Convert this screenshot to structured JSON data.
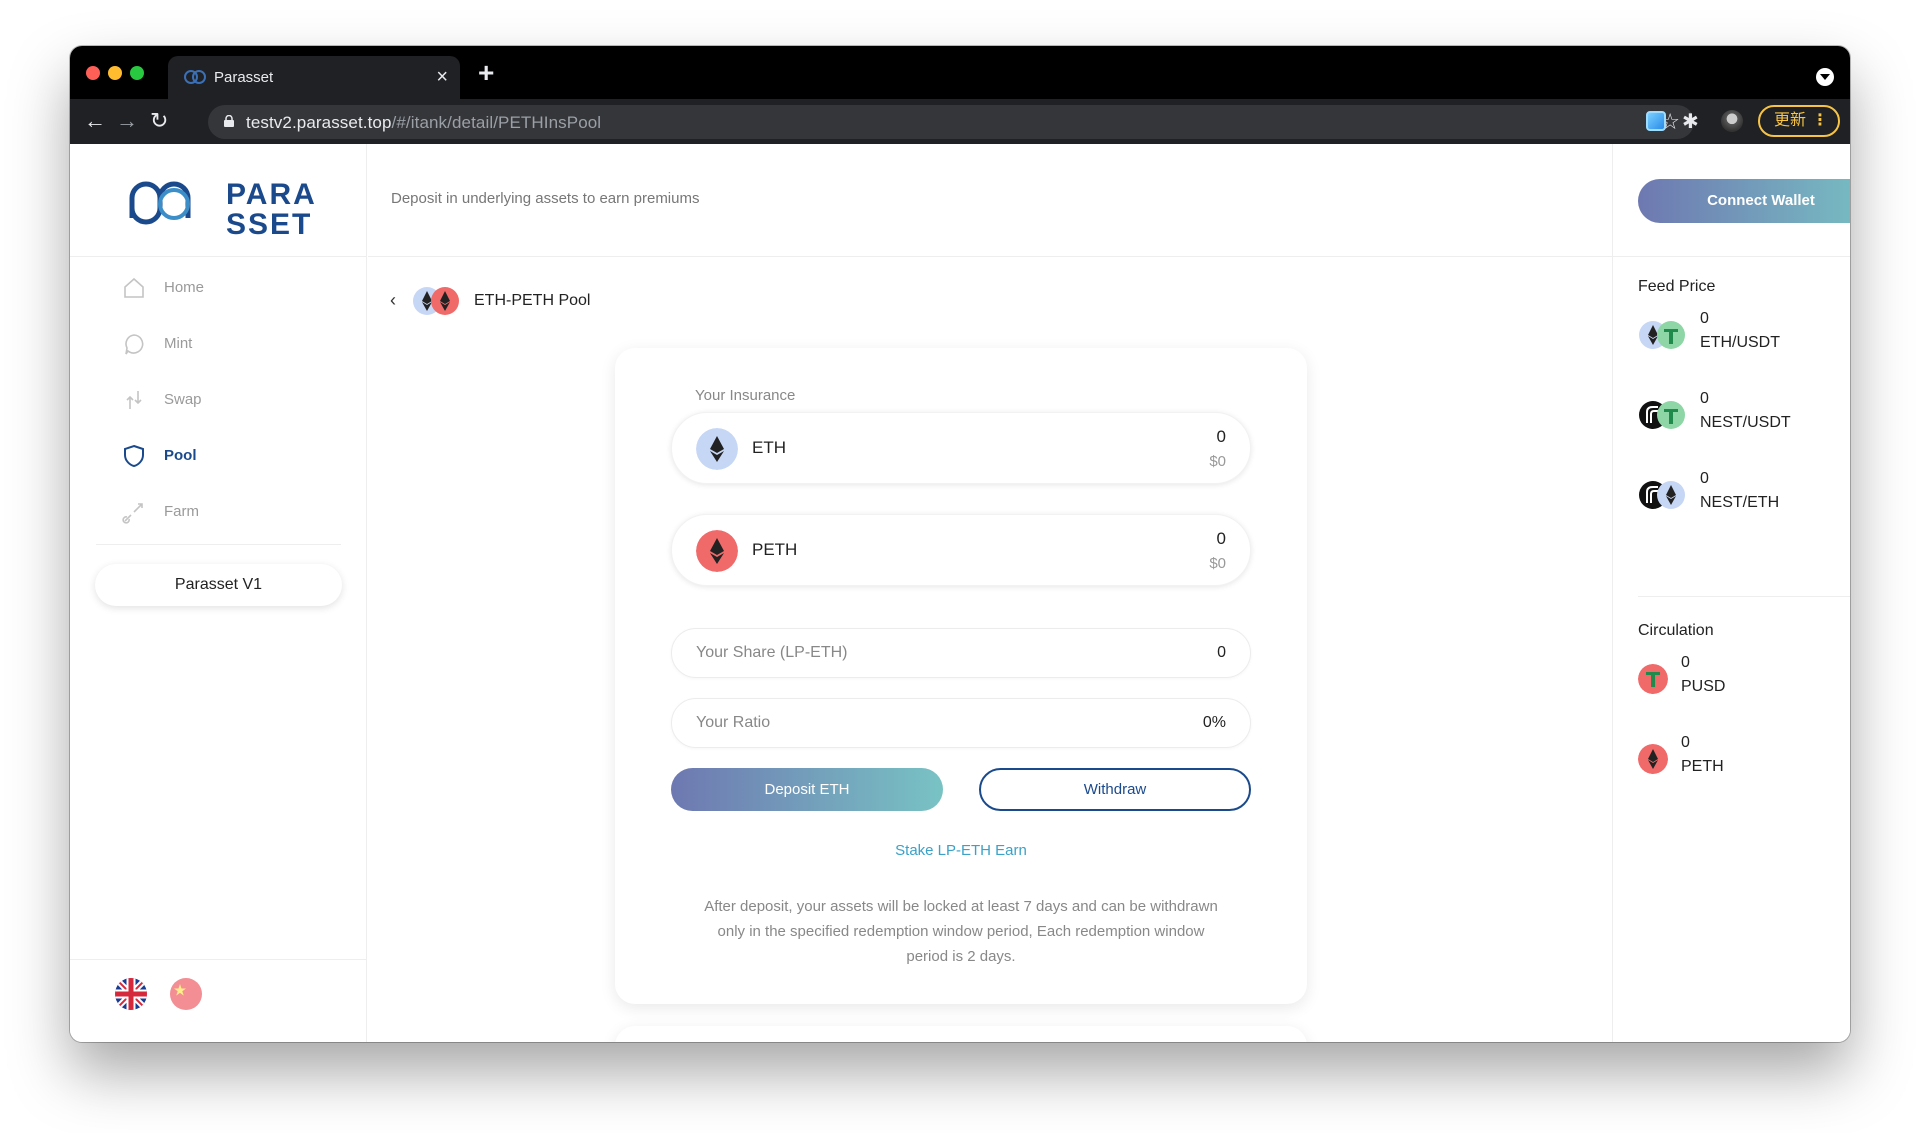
{
  "browser": {
    "tab_title": "Parasset",
    "tab_close": "×",
    "new_tab": "+",
    "url_host": "testv2.parasset.top",
    "url_path": "/#/itank/detail/PETHInsPool",
    "update_label": "更新",
    "update_menu": "⋮"
  },
  "sidebar": {
    "logo_text_top": "PARA",
    "logo_text_bottom": "SSET",
    "items": [
      {
        "label": "Home",
        "icon": "home-icon",
        "active": false
      },
      {
        "label": "Mint",
        "icon": "mint-icon",
        "active": false
      },
      {
        "label": "Swap",
        "icon": "swap-icon",
        "active": false
      },
      {
        "label": "Pool",
        "icon": "shield-icon",
        "active": true
      },
      {
        "label": "Farm",
        "icon": "farm-icon",
        "active": false
      }
    ],
    "version_button": "Parasset V1",
    "languages": [
      "en-flag",
      "zh-flag"
    ]
  },
  "header": {
    "subtitle": "Deposit in underlying assets to earn premiums"
  },
  "pool": {
    "back": "‹",
    "title": "ETH-PETH Pool"
  },
  "card": {
    "label": "Your Insurance",
    "assets": [
      {
        "name": "ETH",
        "value": "0",
        "usd": "$0"
      },
      {
        "name": "PETH",
        "value": "0",
        "usd": "$0"
      }
    ],
    "share_label": "Your Share (LP-ETH)",
    "share_value": "0",
    "ratio_label": "Your Ratio",
    "ratio_value": "0%",
    "deposit_label": "Deposit ETH",
    "withdraw_label": "Withdraw",
    "stake_label": "Stake LP-ETH Earn",
    "note_line1": "After deposit, your assets will be locked at least 7 days and can be withdrawn",
    "note_line2": "only in the specified redemption window period, Each redemption window",
    "note_line3": "period is 2 days."
  },
  "right": {
    "connect_label": "Connect Wallet",
    "feed_title": "Feed Price",
    "feeds": [
      {
        "value": "0",
        "pair": "ETH/USDT"
      },
      {
        "value": "0",
        "pair": "NEST/USDT"
      },
      {
        "value": "0",
        "pair": "NEST/ETH"
      }
    ],
    "circulation_title": "Circulation",
    "circulation": [
      {
        "value": "0",
        "name": "PUSD"
      },
      {
        "value": "0",
        "name": "PETH"
      }
    ]
  },
  "colors": {
    "brand": "#1b4a8c",
    "gradient_start": "#6e78b1",
    "gradient_end": "#78c3c4",
    "link": "#3aa1c8"
  }
}
